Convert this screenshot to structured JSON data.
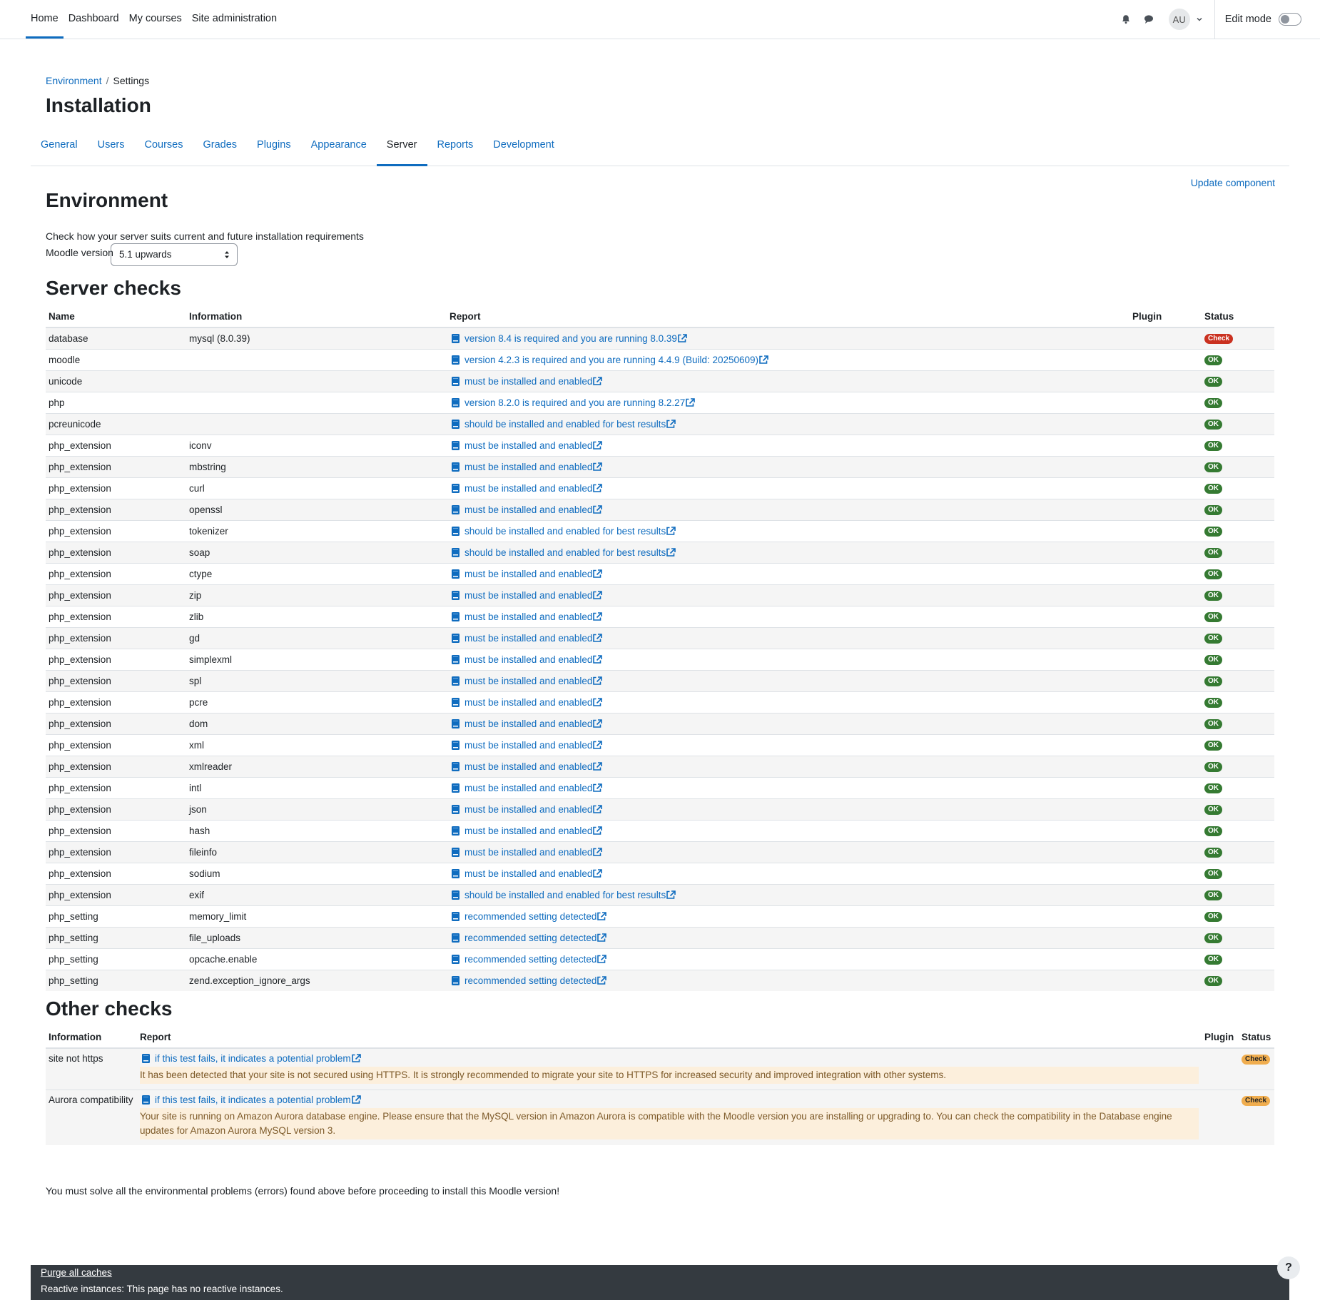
{
  "nav": [
    "Home",
    "Dashboard",
    "My courses",
    "Site administration"
  ],
  "user": {
    "initials": "AU",
    "edit_mode": "Edit mode"
  },
  "breadcrumb": {
    "parent": "Environment",
    "sep": "/",
    "current": "Settings"
  },
  "page_title": "Installation",
  "tabs": [
    "General",
    "Users",
    "Courses",
    "Grades",
    "Plugins",
    "Appearance",
    "Server",
    "Reports",
    "Development"
  ],
  "active_tab": "Server",
  "update_component": "Update component",
  "env": {
    "title": "Environment",
    "description": "Check how your server suits current and future installation requirements",
    "version_label": "Moodle version",
    "version_value": "5.1 upwards"
  },
  "server_checks": {
    "title": "Server checks",
    "headers": [
      "Name",
      "Information",
      "Report",
      "Plugin",
      "Status"
    ],
    "rows": [
      [
        "database",
        "mysql (8.0.39)",
        "version 8.4 is required and you are running 8.0.39",
        "",
        "Check"
      ],
      [
        "moodle",
        "",
        "version 4.2.3 is required and you are running 4.4.9 (Build: 20250609)",
        "",
        "OK"
      ],
      [
        "unicode",
        "",
        "must be installed and enabled",
        "",
        "OK"
      ],
      [
        "php",
        "",
        "version 8.2.0 is required and you are running 8.2.27",
        "",
        "OK"
      ],
      [
        "pcreunicode",
        "",
        "should be installed and enabled for best results",
        "",
        "OK"
      ],
      [
        "php_extension",
        "iconv",
        "must be installed and enabled",
        "",
        "OK"
      ],
      [
        "php_extension",
        "mbstring",
        "must be installed and enabled",
        "",
        "OK"
      ],
      [
        "php_extension",
        "curl",
        "must be installed and enabled",
        "",
        "OK"
      ],
      [
        "php_extension",
        "openssl",
        "must be installed and enabled",
        "",
        "OK"
      ],
      [
        "php_extension",
        "tokenizer",
        "should be installed and enabled for best results",
        "",
        "OK"
      ],
      [
        "php_extension",
        "soap",
        "should be installed and enabled for best results",
        "",
        "OK"
      ],
      [
        "php_extension",
        "ctype",
        "must be installed and enabled",
        "",
        "OK"
      ],
      [
        "php_extension",
        "zip",
        "must be installed and enabled",
        "",
        "OK"
      ],
      [
        "php_extension",
        "zlib",
        "must be installed and enabled",
        "",
        "OK"
      ],
      [
        "php_extension",
        "gd",
        "must be installed and enabled",
        "",
        "OK"
      ],
      [
        "php_extension",
        "simplexml",
        "must be installed and enabled",
        "",
        "OK"
      ],
      [
        "php_extension",
        "spl",
        "must be installed and enabled",
        "",
        "OK"
      ],
      [
        "php_extension",
        "pcre",
        "must be installed and enabled",
        "",
        "OK"
      ],
      [
        "php_extension",
        "dom",
        "must be installed and enabled",
        "",
        "OK"
      ],
      [
        "php_extension",
        "xml",
        "must be installed and enabled",
        "",
        "OK"
      ],
      [
        "php_extension",
        "xmlreader",
        "must be installed and enabled",
        "",
        "OK"
      ],
      [
        "php_extension",
        "intl",
        "must be installed and enabled",
        "",
        "OK"
      ],
      [
        "php_extension",
        "json",
        "must be installed and enabled",
        "",
        "OK"
      ],
      [
        "php_extension",
        "hash",
        "must be installed and enabled",
        "",
        "OK"
      ],
      [
        "php_extension",
        "fileinfo",
        "must be installed and enabled",
        "",
        "OK"
      ],
      [
        "php_extension",
        "sodium",
        "must be installed and enabled",
        "",
        "OK"
      ],
      [
        "php_extension",
        "exif",
        "should be installed and enabled for best results",
        "",
        "OK"
      ],
      [
        "php_setting",
        "memory_limit",
        "recommended setting detected",
        "",
        "OK"
      ],
      [
        "php_setting",
        "file_uploads",
        "recommended setting detected",
        "",
        "OK"
      ],
      [
        "php_setting",
        "opcache.enable",
        "recommended setting detected",
        "",
        "OK"
      ],
      [
        "php_setting",
        "zend.exception_ignore_args",
        "recommended setting detected",
        "",
        "OK"
      ]
    ]
  },
  "other_checks": {
    "title": "Other checks",
    "headers": [
      "Information",
      "Report",
      "Plugin",
      "Status"
    ],
    "rows": [
      {
        "info": "site not https",
        "report": "if this test fails, it indicates a potential problem",
        "message": "It has been detected that your site is not secured using HTTPS. It is strongly recommended to migrate your site to HTTPS for increased security and improved integration with other systems.",
        "plugin": "",
        "status": "Check"
      },
      {
        "info": "Aurora compatibility",
        "report": "if this test fails, it indicates a potential problem",
        "message": "Your site is running on Amazon Aurora database engine. Please ensure that the MySQL version in Amazon Aurora is compatible with the Moodle version you are installing or upgrading to. You can check the compatibility in the Database engine updates for Amazon Aurora MySQL version 3.",
        "plugin": "",
        "status": "Check"
      }
    ]
  },
  "final_message": "You must solve all the environmental problems (errors) found above before proceeding to install this Moodle version!",
  "footer": {
    "purge": "Purge all caches",
    "reactive": "Reactive instances: This page has no reactive instances."
  },
  "help_label": "?",
  "colors": {
    "link": "#0f6cbf",
    "ok": "#357a32",
    "error": "#ca3120",
    "warning": "#f0ad4e",
    "footer": "#343a40"
  }
}
